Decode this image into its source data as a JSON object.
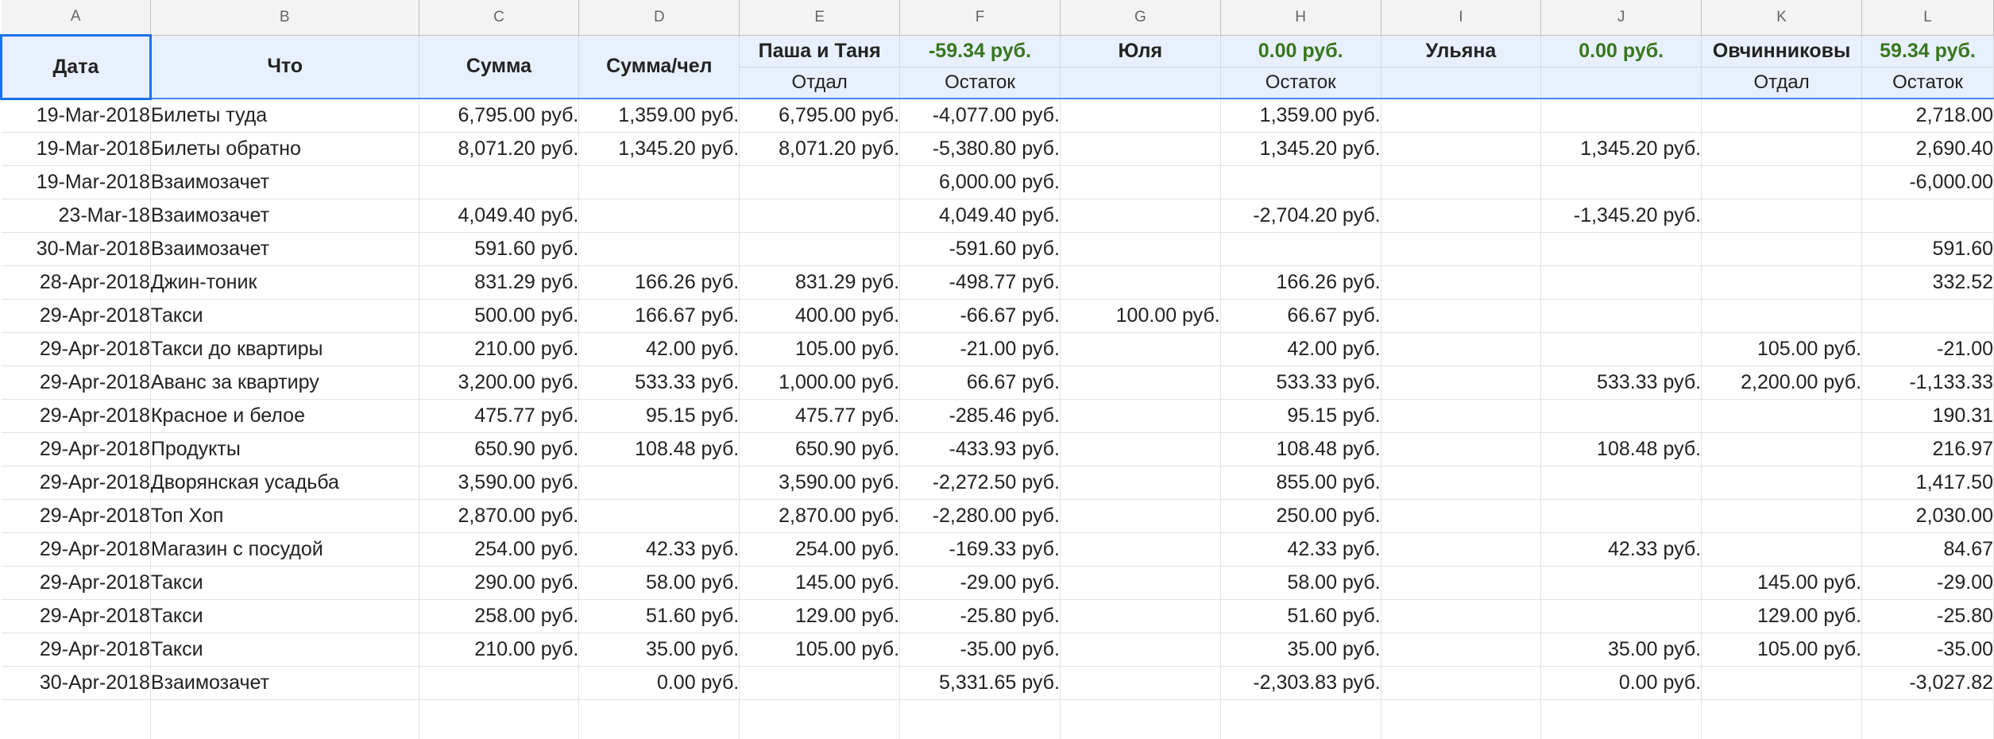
{
  "column_letters": [
    "A",
    "B",
    "C",
    "D",
    "E",
    "F",
    "G",
    "H",
    "I",
    "J",
    "K",
    "L"
  ],
  "header": {
    "date": "Дата",
    "what": "Что",
    "sum": "Сумма",
    "per_person": "Сумма/чел",
    "pasha_tanya": "Паша и Таня",
    "pasha_tanya_balance": "-59.34 руб.",
    "yulia": "Юля",
    "yulia_balance": "0.00 руб.",
    "ulyana": "Ульяна",
    "ulyana_balance": "0.00 руб.",
    "ovchinnikovy": "Овчинниковы",
    "ovchinnikovy_balance": "59.34 руб.",
    "paid": "Отдал",
    "remainder": "Остаток"
  },
  "rows": [
    [
      "19-Mar-2018",
      "Билеты туда",
      "6,795.00 руб.",
      "1,359.00 руб.",
      "6,795.00 руб.",
      "-4,077.00 руб.",
      "",
      "1,359.00 руб.",
      "",
      "",
      "",
      "2,718.00"
    ],
    [
      "19-Mar-2018",
      "Билеты обратно",
      "8,071.20 руб.",
      "1,345.20 руб.",
      "8,071.20 руб.",
      "-5,380.80 руб.",
      "",
      "1,345.20 руб.",
      "",
      "1,345.20 руб.",
      "",
      "2,690.40"
    ],
    [
      "19-Mar-2018",
      "Взаимозачет",
      "",
      "",
      "",
      "6,000.00 руб.",
      "",
      "",
      "",
      "",
      "",
      "-6,000.00"
    ],
    [
      "23-Mar-18",
      "Взаимозачет",
      "4,049.40 руб.",
      "",
      "",
      "4,049.40 руб.",
      "",
      "-2,704.20 руб.",
      "",
      "-1,345.20 руб.",
      "",
      ""
    ],
    [
      "30-Mar-2018",
      "Взаимозачет",
      "591.60 руб.",
      "",
      "",
      "-591.60 руб.",
      "",
      "",
      "",
      "",
      "",
      "591.60"
    ],
    [
      "28-Apr-2018",
      "Джин-тоник",
      "831.29 руб.",
      "166.26 руб.",
      "831.29 руб.",
      "-498.77 руб.",
      "",
      "166.26 руб.",
      "",
      "",
      "",
      "332.52"
    ],
    [
      "29-Apr-2018",
      "Такси",
      "500.00 руб.",
      "166.67 руб.",
      "400.00 руб.",
      "-66.67 руб.",
      "100.00 руб.",
      "66.67 руб.",
      "",
      "",
      "",
      ""
    ],
    [
      "29-Apr-2018",
      "Такси до квартиры",
      "210.00 руб.",
      "42.00 руб.",
      "105.00 руб.",
      "-21.00 руб.",
      "",
      "42.00 руб.",
      "",
      "",
      "105.00 руб.",
      "-21.00"
    ],
    [
      "29-Apr-2018",
      "Аванс за квартиру",
      "3,200.00 руб.",
      "533.33 руб.",
      "1,000.00 руб.",
      "66.67 руб.",
      "",
      "533.33 руб.",
      "",
      "533.33 руб.",
      "2,200.00 руб.",
      "-1,133.33"
    ],
    [
      "29-Apr-2018",
      "Красное и белое",
      "475.77 руб.",
      "95.15 руб.",
      "475.77 руб.",
      "-285.46 руб.",
      "",
      "95.15 руб.",
      "",
      "",
      "",
      "190.31"
    ],
    [
      "29-Apr-2018",
      "Продукты",
      "650.90 руб.",
      "108.48 руб.",
      "650.90 руб.",
      "-433.93 руб.",
      "",
      "108.48 руб.",
      "",
      "108.48 руб.",
      "",
      "216.97"
    ],
    [
      "29-Apr-2018",
      "Дворянская усадьба",
      "3,590.00 руб.",
      "",
      "3,590.00 руб.",
      "-2,272.50 руб.",
      "",
      "855.00 руб.",
      "",
      "",
      "",
      "1,417.50"
    ],
    [
      "29-Apr-2018",
      "Топ Хоп",
      "2,870.00 руб.",
      "",
      "2,870.00 руб.",
      "-2,280.00 руб.",
      "",
      "250.00 руб.",
      "",
      "",
      "",
      "2,030.00"
    ],
    [
      "29-Apr-2018",
      "Магазин с посудой",
      "254.00 руб.",
      "42.33 руб.",
      "254.00 руб.",
      "-169.33 руб.",
      "",
      "42.33 руб.",
      "",
      "42.33 руб.",
      "",
      "84.67"
    ],
    [
      "29-Apr-2018",
      "Такси",
      "290.00 руб.",
      "58.00 руб.",
      "145.00 руб.",
      "-29.00 руб.",
      "",
      "58.00 руб.",
      "",
      "",
      "145.00 руб.",
      "-29.00"
    ],
    [
      "29-Apr-2018",
      "Такси",
      "258.00 руб.",
      "51.60 руб.",
      "129.00 руб.",
      "-25.80 руб.",
      "",
      "51.60 руб.",
      "",
      "",
      "129.00 руб.",
      "-25.80"
    ],
    [
      "29-Apr-2018",
      "Такси",
      "210.00 руб.",
      "35.00 руб.",
      "105.00 руб.",
      "-35.00 руб.",
      "",
      "35.00 руб.",
      "",
      "35.00 руб.",
      "105.00 руб.",
      "-35.00"
    ],
    [
      "30-Apr-2018",
      "Взаимозачет",
      "",
      "0.00 руб.",
      "",
      "5,331.65 руб.",
      "",
      "-2,303.83 руб.",
      "",
      "0.00 руб.",
      "",
      "-3,027.82"
    ]
  ]
}
